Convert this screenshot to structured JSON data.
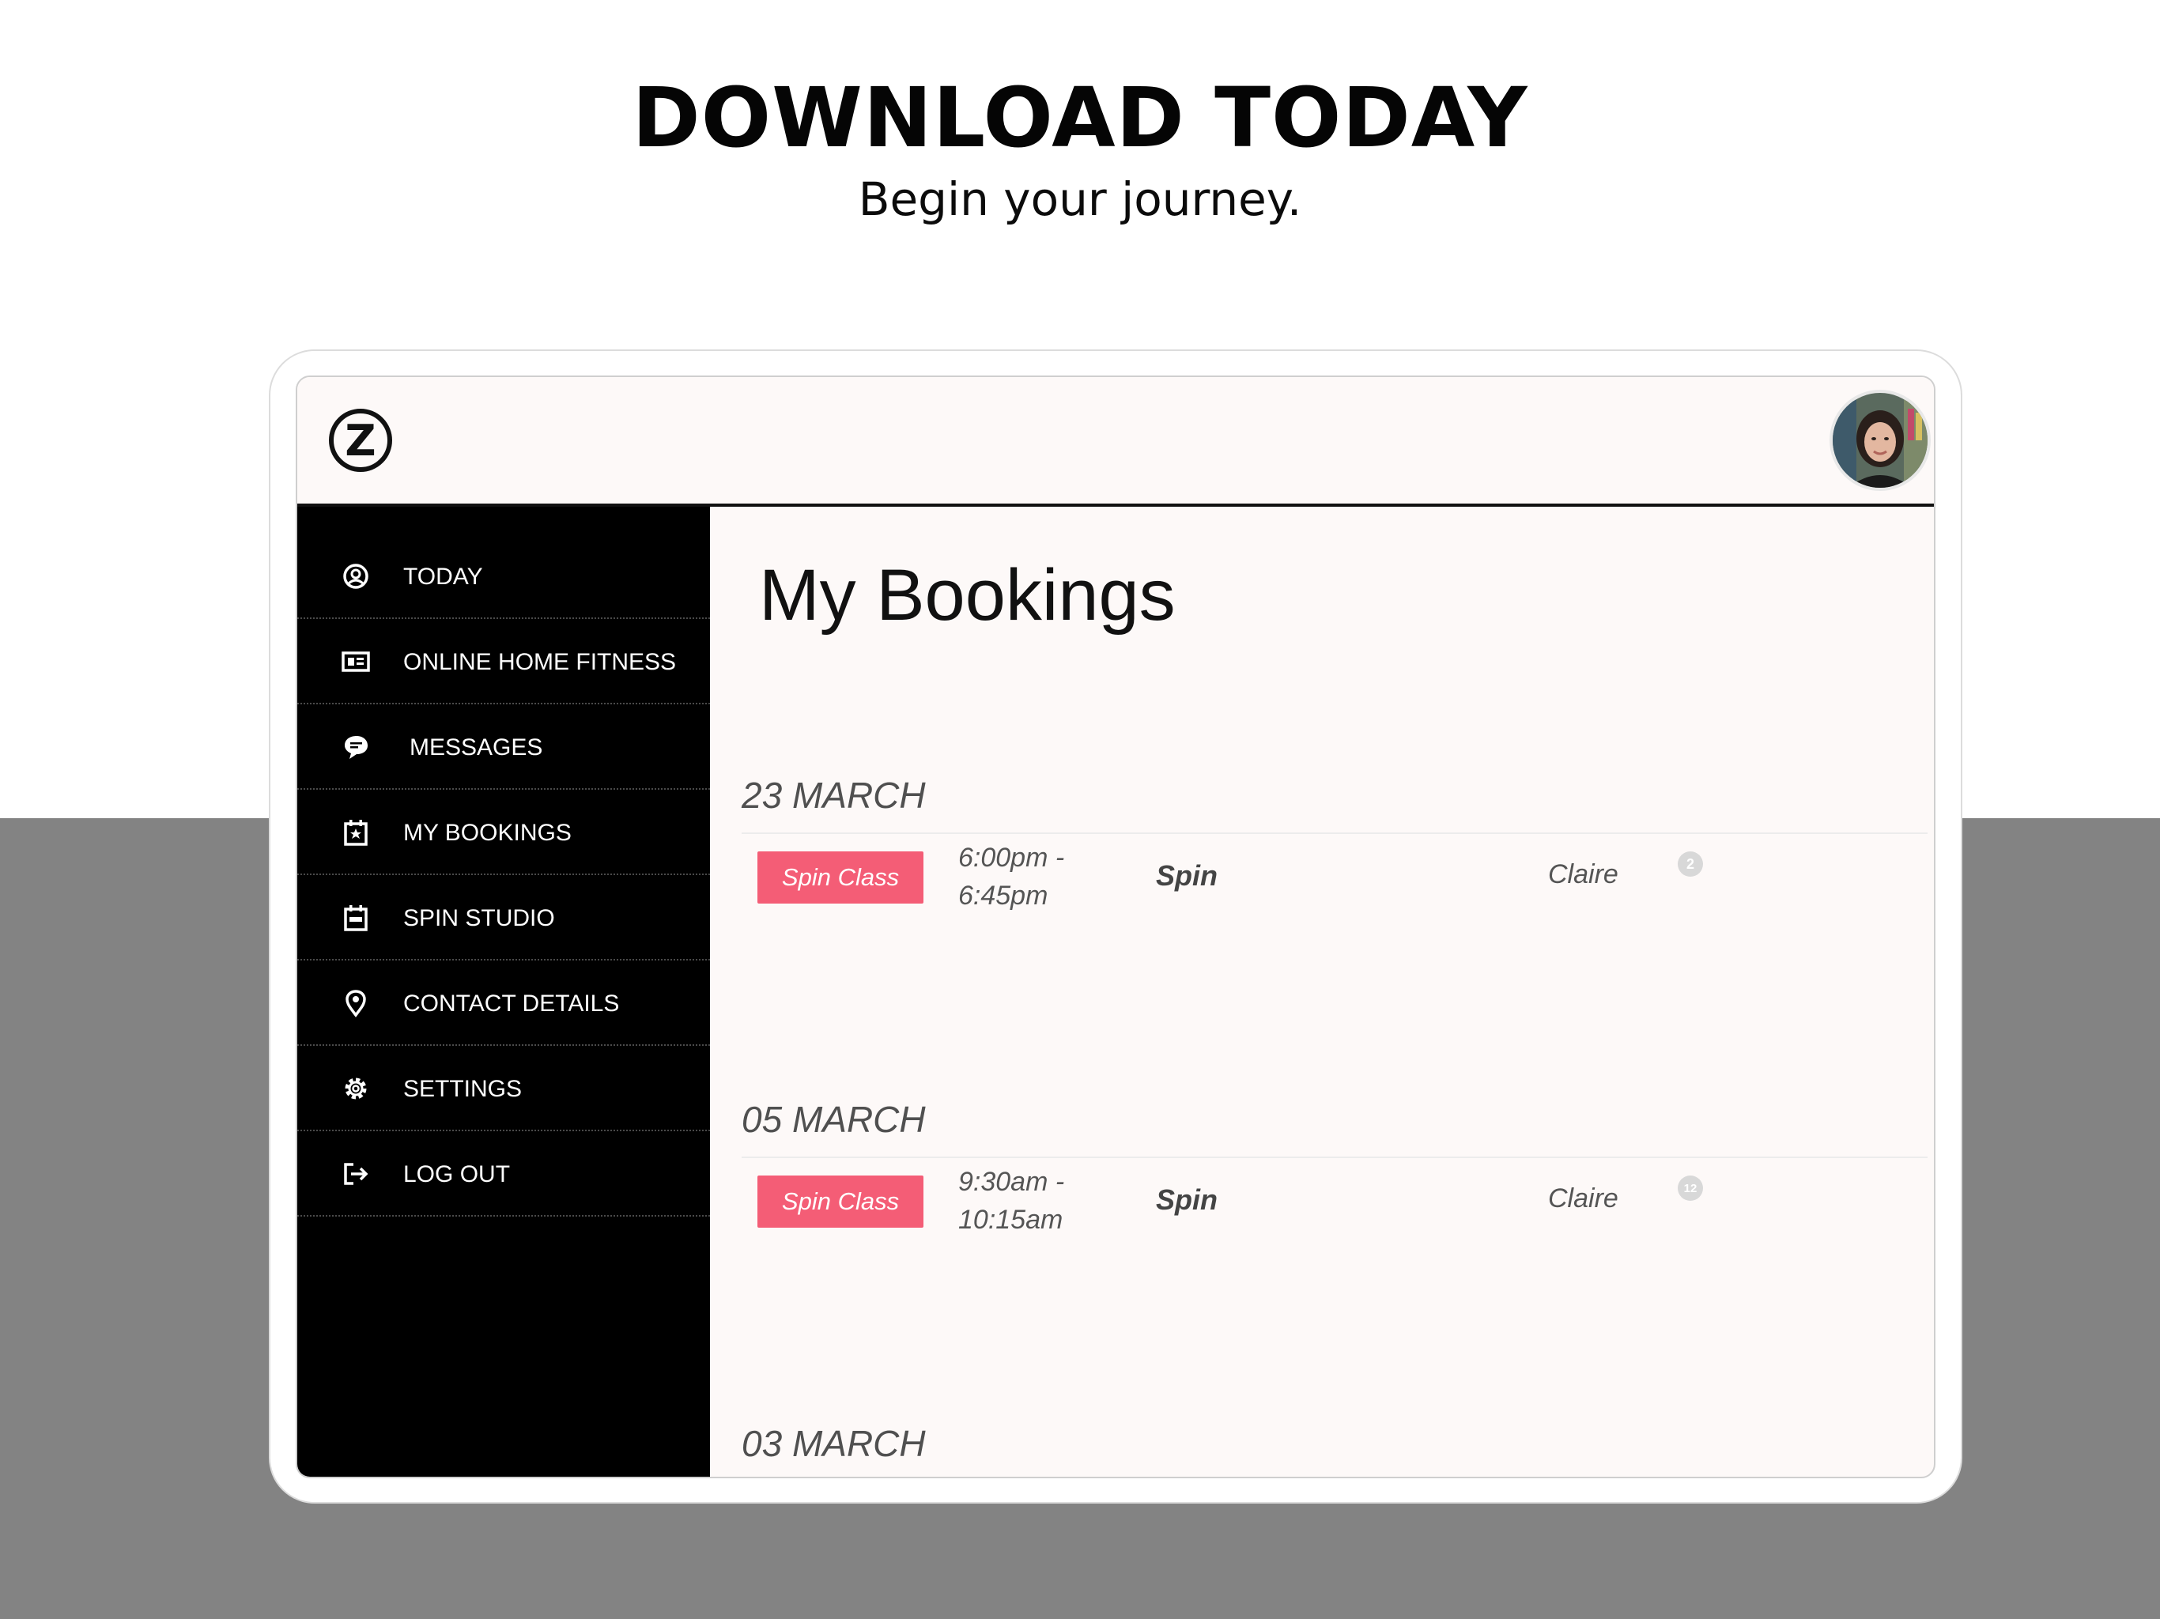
{
  "promo": {
    "headline": "DOWNLOAD TODAY",
    "subheadline": "Begin your journey."
  },
  "app": {
    "logo_letter": "Z",
    "nav": [
      {
        "label": "TODAY",
        "icon": "user-circle-icon"
      },
      {
        "label": "ONLINE HOME FITNESS",
        "icon": "video-card-icon"
      },
      {
        "label": "MESSAGES",
        "icon": "chat-bubble-icon"
      },
      {
        "label": "MY BOOKINGS",
        "icon": "calendar-star-icon"
      },
      {
        "label": "SPIN STUDIO",
        "icon": "calendar-icon"
      },
      {
        "label": "CONTACT DETAILS",
        "icon": "map-pin-icon"
      },
      {
        "label": "SETTINGS",
        "icon": "gear-icon"
      },
      {
        "label": "LOG OUT",
        "icon": "logout-icon"
      }
    ],
    "page_title": "My Bookings",
    "bookings": [
      {
        "date": "23 MARCH",
        "tag": "Spin Class",
        "time_start": "6:00pm -",
        "time_end": "6:45pm",
        "class": "Spin",
        "instructor": "Claire",
        "badge": "2"
      },
      {
        "date": "05 MARCH",
        "tag": "Spin Class",
        "time_start": "9:30am -",
        "time_end": "10:15am",
        "class": "Spin",
        "instructor": "Claire",
        "badge": "12"
      },
      {
        "date": "03 MARCH"
      }
    ],
    "colors": {
      "accent": "#f45d76",
      "sidebar": "#000000",
      "content_bg": "#fdf9f8"
    }
  }
}
